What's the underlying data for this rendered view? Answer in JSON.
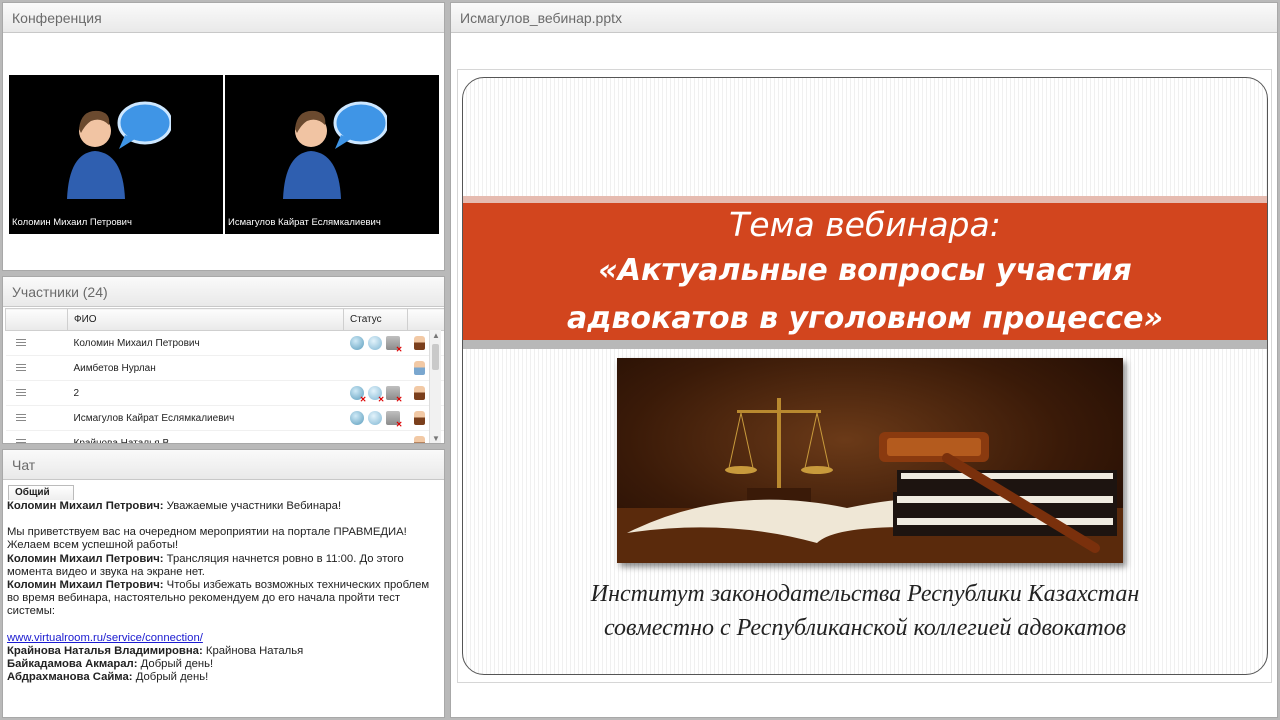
{
  "conference": {
    "title": "Конференция",
    "videos": [
      {
        "name": "Коломин Михаил Петрович"
      },
      {
        "name": "Исмагулов Кайрат Еслямкалиевич"
      }
    ]
  },
  "participants": {
    "title": "Участники (24)",
    "columns": {
      "fio": "ФИО",
      "status": "Статус"
    },
    "rows": [
      {
        "name": "Коломин Михаил Петрович"
      },
      {
        "name": "Аимбетов Нурлан"
      },
      {
        "name": "2"
      },
      {
        "name": "Исмагулов Кайрат Еслямкалиевич"
      },
      {
        "name": "Крайнова Наталья В..."
      }
    ]
  },
  "chat": {
    "title": "Чат",
    "tab": "Общий",
    "messages": [
      {
        "author": "Коломин Михаил Петрович:",
        "text": " Уважаемые участники Вебинара!"
      },
      {
        "author": "",
        "text": "Мы приветствуем вас на очередном мероприятии на портале ПРАВМЕДИА! Желаем всем успешной работы!"
      },
      {
        "author": "Коломин Михаил Петрович:",
        "text": " Трансляция начнется ровно в 11:00. До этого момента видео и звука на экране нет."
      },
      {
        "author": "Коломин Михаил Петрович:",
        "text": " Чтобы избежать возможных технических проблем во время вебинара, настоятельно рекомендуем до его начала пройти тест системы:"
      }
    ],
    "link": "www.virtualroom.ru/service/connection/",
    "messages2": [
      {
        "author": "Крайнова Наталья  Владимировна:",
        "text": " Крайнова Наталья"
      },
      {
        "author": "Байкадамова Акмарал:",
        "text": " Добрый день!"
      },
      {
        "author": "Абдрахманова Сайма:",
        "text": " Добрый день!"
      }
    ]
  },
  "presentation": {
    "title": "Исмагулов_вебинар.pptx",
    "slide": {
      "line1": "Тема вебинара:",
      "line2": "«Актуальные вопросы участия",
      "line3": "адвокатов в уголовном процессе»",
      "footer1": "Институт законодательства Республики Казахстан",
      "footer2": "совместно с Республиканской коллегией адвокатов"
    }
  },
  "colors": {
    "band": "#d2451e",
    "link": "#1a1ad0"
  }
}
